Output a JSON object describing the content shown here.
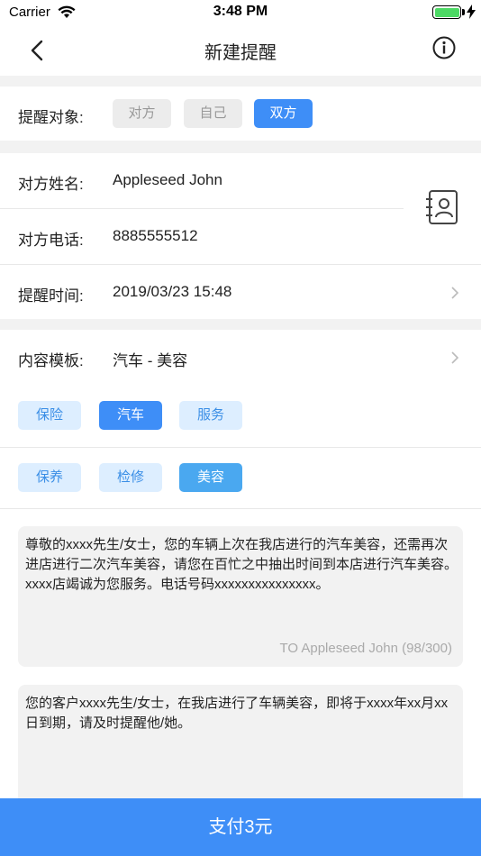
{
  "status": {
    "carrier": "Carrier",
    "time": "3:48 PM"
  },
  "nav": {
    "title": "新建提醒"
  },
  "remind_target": {
    "label": "提醒对象:",
    "options": [
      "对方",
      "自己",
      "双方"
    ],
    "selected": "双方"
  },
  "contact": {
    "name_label": "对方姓名:",
    "name_value": "Appleseed John",
    "phone_label": "对方电话:",
    "phone_value": "8885555512",
    "time_label": "提醒时间:",
    "time_value": "2019/03/23 15:48"
  },
  "template": {
    "label": "内容模板:",
    "value": "汽车 - 美容",
    "categories": [
      "保险",
      "汽车",
      "服务"
    ],
    "selected_category": "汽车",
    "subcategories": [
      "保养",
      "检修",
      "美容"
    ],
    "selected_subcategory": "美容"
  },
  "messages": {
    "to_other": "尊敬的xxxx先生/女士，您的车辆上次在我店进行的汽车美容，还需再次进店进行二次汽车美容，请您在百忙之中抽出时间到本店进行汽车美容。xxxx店竭诚为您服务。电话号码xxxxxxxxxxxxxxx。",
    "to_other_meta": "TO Appleseed John (98/300)",
    "to_self": "您的客户xxxx先生/女士，在我店进行了车辆美容，即将于xxxx年xx月xx日到期，请及时提醒他/她。"
  },
  "pay": {
    "label": "支付3元"
  },
  "colors": {
    "accent": "#3e8ef7",
    "selected_light": "#ddeeff",
    "battery": "#4cd964"
  }
}
